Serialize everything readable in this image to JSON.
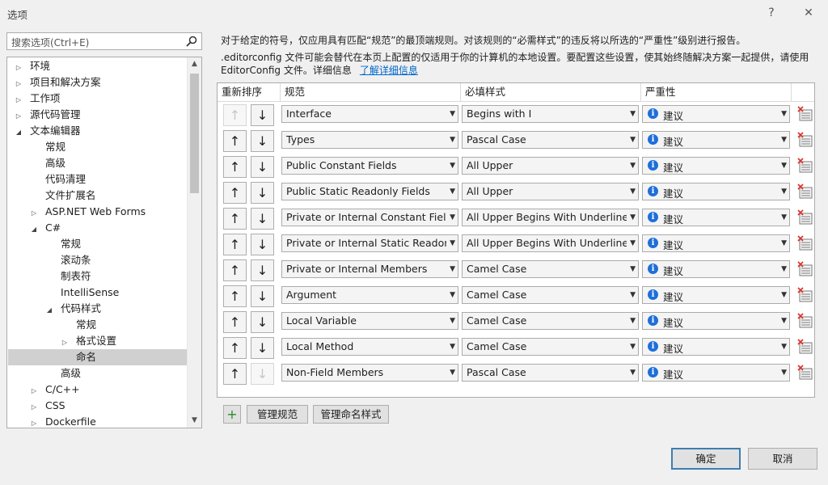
{
  "window": {
    "title": "选项",
    "help": "?",
    "close": "✕"
  },
  "search": {
    "placeholder": "搜索选项(Ctrl+E)"
  },
  "tree": [
    {
      "label": "环境",
      "indent": 0,
      "arrow": "▷"
    },
    {
      "label": "项目和解决方案",
      "indent": 0,
      "arrow": "▷"
    },
    {
      "label": "工作项",
      "indent": 0,
      "arrow": "▷"
    },
    {
      "label": "源代码管理",
      "indent": 0,
      "arrow": "▷"
    },
    {
      "label": "文本编辑器",
      "indent": 0,
      "arrow": "◢"
    },
    {
      "label": "常规",
      "indent": 1,
      "arrow": ""
    },
    {
      "label": "高级",
      "indent": 1,
      "arrow": ""
    },
    {
      "label": "代码清理",
      "indent": 1,
      "arrow": ""
    },
    {
      "label": "文件扩展名",
      "indent": 1,
      "arrow": ""
    },
    {
      "label": "ASP.NET Web Forms",
      "indent": 1,
      "arrow": "▷"
    },
    {
      "label": "C#",
      "indent": 1,
      "arrow": "◢"
    },
    {
      "label": "常规",
      "indent": 2,
      "arrow": ""
    },
    {
      "label": "滚动条",
      "indent": 2,
      "arrow": ""
    },
    {
      "label": "制表符",
      "indent": 2,
      "arrow": ""
    },
    {
      "label": "IntelliSense",
      "indent": 2,
      "arrow": ""
    },
    {
      "label": "代码样式",
      "indent": 2,
      "arrow": "◢"
    },
    {
      "label": "常规",
      "indent": 3,
      "arrow": ""
    },
    {
      "label": "格式设置",
      "indent": 3,
      "arrow": "▷"
    },
    {
      "label": "命名",
      "indent": 3,
      "arrow": "",
      "selected": true
    },
    {
      "label": "高级",
      "indent": 2,
      "arrow": ""
    },
    {
      "label": "C/C++",
      "indent": 1,
      "arrow": "▷"
    },
    {
      "label": "CSS",
      "indent": 1,
      "arrow": "▷"
    },
    {
      "label": "Dockerfile",
      "indent": 1,
      "arrow": "▷"
    }
  ],
  "description": {
    "line1": "对于给定的符号，仅应用具有匹配“规范”的最顶端规则。对该规则的“必需样式”的违反将以所选的“严重性”级别进行报告。",
    "line2": ".editorconfig 文件可能会替代在本页上配置的仅适用于你的计算机的本地设置。要配置这些设置，使其始终随解决方案一起提供，请使用 EditorConfig 文件。详细信息",
    "link": "了解详细信息"
  },
  "grid": {
    "headers": {
      "reorder": "重新排序",
      "spec": "规范",
      "style": "必填样式",
      "severity": "严重性"
    },
    "up_glyph": "↑",
    "down_glyph": "↓",
    "info_glyph": "i",
    "rows": [
      {
        "spec": "Interface",
        "style": "Begins with I",
        "severity": "建议",
        "up_enabled": false,
        "down_enabled": true
      },
      {
        "spec": "Types",
        "style": "Pascal Case",
        "severity": "建议",
        "up_enabled": true,
        "down_enabled": true
      },
      {
        "spec": "Public Constant Fields",
        "style": "All Upper",
        "severity": "建议",
        "up_enabled": true,
        "down_enabled": true
      },
      {
        "spec": "Public Static Readonly Fields",
        "style": "All Upper",
        "severity": "建议",
        "up_enabled": true,
        "down_enabled": true
      },
      {
        "spec": "Private or Internal Constant Fields",
        "style": "All Upper Begins With Underline",
        "severity": "建议",
        "up_enabled": true,
        "down_enabled": true
      },
      {
        "spec": "Private or Internal Static Readonly Fields",
        "style": "All Upper Begins With Underline",
        "severity": "建议",
        "up_enabled": true,
        "down_enabled": true
      },
      {
        "spec": "Private or Internal Members",
        "style": "Camel Case",
        "severity": "建议",
        "up_enabled": true,
        "down_enabled": true
      },
      {
        "spec": "Argument",
        "style": "Camel Case",
        "severity": "建议",
        "up_enabled": true,
        "down_enabled": true
      },
      {
        "spec": "Local Variable",
        "style": "Camel Case",
        "severity": "建议",
        "up_enabled": true,
        "down_enabled": true
      },
      {
        "spec": "Local Method",
        "style": "Camel Case",
        "severity": "建议",
        "up_enabled": true,
        "down_enabled": true
      },
      {
        "spec": "Non-Field Members",
        "style": "Pascal Case",
        "severity": "建议",
        "up_enabled": true,
        "down_enabled": false
      }
    ]
  },
  "buttons": {
    "add": "+",
    "manage_specs": "管理规范",
    "manage_styles": "管理命名样式",
    "ok": "确定",
    "cancel": "取消"
  },
  "colors": {
    "info": "#1e6fd9",
    "link": "#0066cc",
    "selection": "#d0d0d0",
    "delete_red": "#d9342b"
  }
}
